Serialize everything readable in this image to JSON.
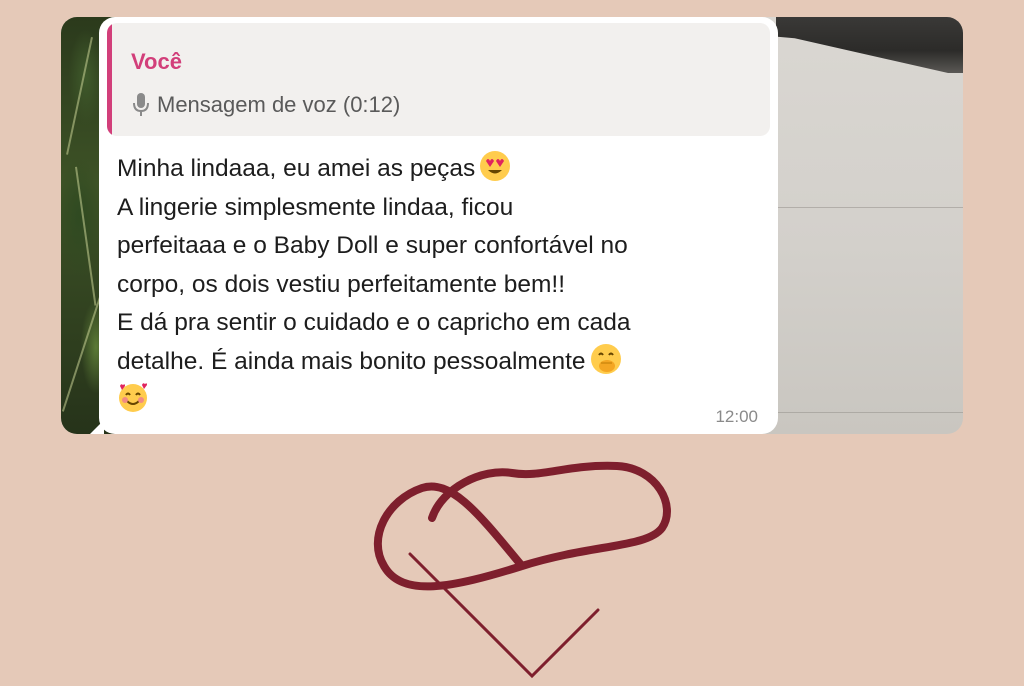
{
  "quote": {
    "author": "Você",
    "icon": "microphone-icon",
    "text": "Mensagem de voz (0:12)"
  },
  "message": {
    "lines": [
      "Minha lindaaa, eu amei as peças",
      "A lingerie simplesmente lindaa, ficou",
      "perfeitaaa e o Baby Doll e super confortável no",
      "corpo, os dois vestiu perfeitamente bem!!",
      "E dá pra sentir o cuidado e o capricho em cada",
      "detalhe. É ainda mais bonito pessoalmente"
    ],
    "emojis": [
      "heart-eyes-emoji",
      "hand-over-mouth-emoji",
      "smiling-face-with-hearts-emoji"
    ],
    "time": "12:00"
  },
  "colors": {
    "background": "#e5c9b8",
    "accent": "#d23f7a",
    "logo": "#7e1f2d",
    "bubble": "#ffffff"
  },
  "logo": {
    "icon": "infinity-heart-logo"
  }
}
